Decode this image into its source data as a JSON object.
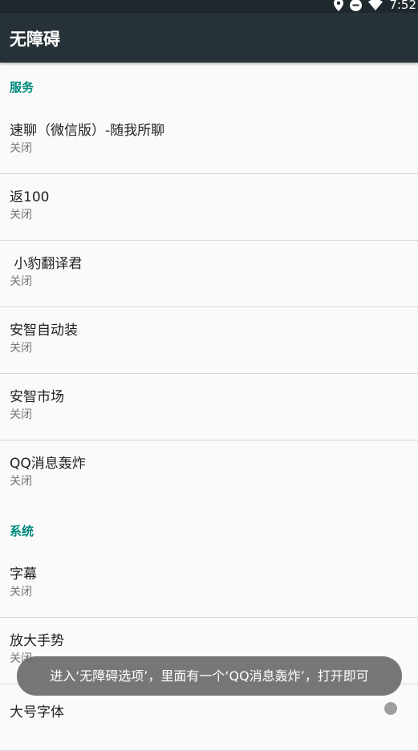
{
  "status_bar": {
    "time": "7:52",
    "icons": [
      "location-icon",
      "do-not-disturb-icon",
      "wifi-icon"
    ]
  },
  "app_bar": {
    "title": "无障碍"
  },
  "sections": {
    "services": {
      "header": "服务",
      "items": [
        {
          "title": "速聊（微信版）-随我所聊",
          "summary": "关闭"
        },
        {
          "title": "返100",
          "summary": "关闭"
        },
        {
          "title": " 小豹翻译君",
          "summary": "关闭"
        },
        {
          "title": "安智自动装",
          "summary": "关闭"
        },
        {
          "title": "安智市场",
          "summary": "关闭"
        },
        {
          "title": "QQ消息轰炸",
          "summary": "关闭"
        }
      ]
    },
    "system": {
      "header": "系统",
      "items": [
        {
          "title": "字幕",
          "summary": "关闭"
        },
        {
          "title": "放大手势",
          "summary": "关闭"
        },
        {
          "title": "大号字体"
        }
      ]
    }
  },
  "toast": {
    "message": "进入‘无障碍选项’，里面有一个‘QQ消息轰炸’，打开即可"
  },
  "colors": {
    "app_bar": "#263238",
    "status_bar": "#1f282d",
    "accent": "#00897b",
    "background": "#fafafa"
  }
}
